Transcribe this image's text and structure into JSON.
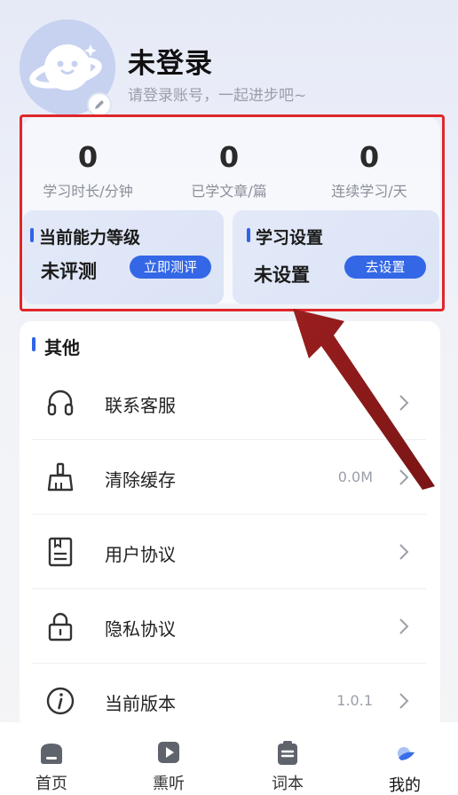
{
  "profile": {
    "name": "未登录",
    "subtitle": "请登录账号，一起进步吧~"
  },
  "stats": [
    {
      "value": "0",
      "label": "学习时长/分钟"
    },
    {
      "value": "0",
      "label": "已学文章/篇"
    },
    {
      "value": "0",
      "label": "连续学习/天"
    }
  ],
  "panels": {
    "level": {
      "title": "当前能力等级",
      "value": "未评测",
      "button": "立即测评"
    },
    "settings": {
      "title": "学习设置",
      "value": "未设置",
      "button": "去设置"
    }
  },
  "others": {
    "title": "其他",
    "items": [
      {
        "label": "联系客服",
        "value": "",
        "icon": "headphones-icon"
      },
      {
        "label": "清除缓存",
        "value": "0.0M",
        "icon": "broom-icon"
      },
      {
        "label": "用户协议",
        "value": "",
        "icon": "document-icon"
      },
      {
        "label": "隐私协议",
        "value": "",
        "icon": "lock-icon"
      },
      {
        "label": "当前版本",
        "value": "1.0.1",
        "icon": "info-icon"
      }
    ]
  },
  "tabs": [
    {
      "label": "首页",
      "icon": "home-icon"
    },
    {
      "label": "熏听",
      "icon": "play-icon"
    },
    {
      "label": "词本",
      "icon": "clipboard-icon"
    },
    {
      "label": "我的",
      "icon": "profile-icon",
      "active": true
    }
  ],
  "colors": {
    "accent": "#3367e6",
    "annotation": "#e0262b",
    "arrow": "#8e1b1b"
  }
}
